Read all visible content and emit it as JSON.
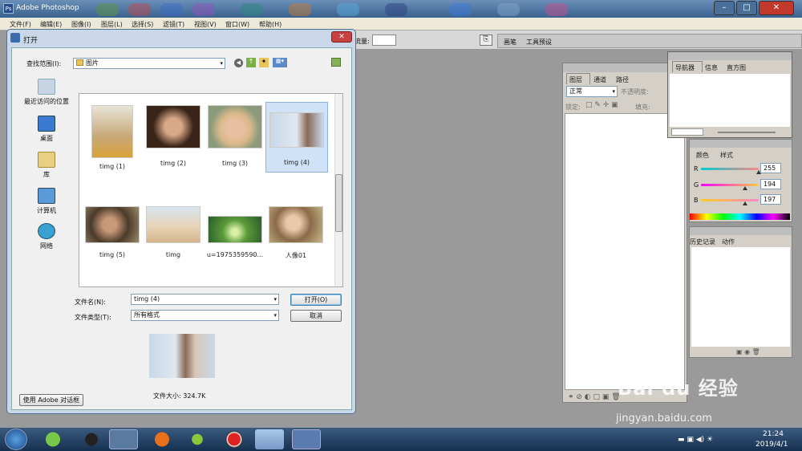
{
  "app": {
    "title": "Adobe Photoshop",
    "menu": [
      "文件(F)",
      "编辑(E)",
      "图像(I)",
      "图层(L)",
      "选择(S)",
      "滤镜(T)",
      "视图(V)",
      "窗口(W)",
      "帮助(H)"
    ],
    "options_bar": {
      "flow_label": "流量:",
      "tabs": [
        "画笔",
        "工具预设"
      ]
    }
  },
  "layers_panel": {
    "tabs": [
      "图层",
      "通道",
      "路径"
    ],
    "blend_mode": "正常",
    "opacity_label": "不透明度:",
    "lock_label": "锁定:",
    "fill_label": "填充:"
  },
  "navigator_panel": {
    "tabs": [
      "导航器",
      "信息",
      "直方图"
    ]
  },
  "color_panel": {
    "tabs": [
      "颜色",
      "样式"
    ],
    "channels": [
      {
        "label": "R",
        "value": "255",
        "fraction": 1.0
      },
      {
        "label": "G",
        "value": "194",
        "fraction": 0.76
      },
      {
        "label": "B",
        "value": "197",
        "fraction": 0.77
      }
    ]
  },
  "history_panel": {
    "tabs": [
      "历史记录",
      "动作"
    ]
  },
  "dialog": {
    "title": "打开",
    "lookin_label": "查找范围(I):",
    "lookin_value": "图片",
    "sidebar": [
      "最近访问的位置",
      "桌面",
      "库",
      "计算机",
      "网络"
    ],
    "files": [
      "timg (1)",
      "timg (2)",
      "timg (3)",
      "timg (4)",
      "timg (5)",
      "timg",
      "u=1975359590...",
      "人像01"
    ],
    "filename_label": "文件名(N):",
    "filename_value": "timg (4)",
    "filetype_label": "文件类型(T):",
    "filetype_value": "所有格式",
    "open_button": "打开(O)",
    "cancel_button": "取消",
    "adobe_dialog_button": "使用 Adobe 对话框",
    "filesize": "文件大小: 324.7K"
  },
  "taskbar": {
    "time": "21:24",
    "date": "2019/4/1"
  },
  "watermark": {
    "brand": "Bai du 经验",
    "url": "jingyan.baidu.com"
  }
}
